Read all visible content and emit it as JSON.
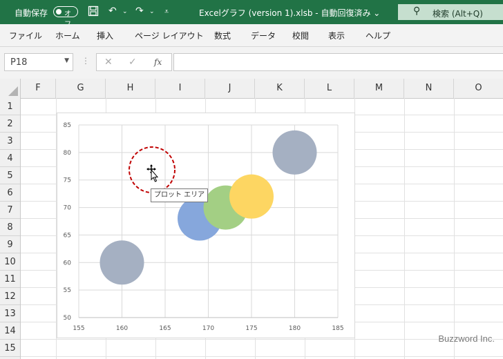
{
  "titlebar": {
    "autosave_label": "自動保存",
    "autosave_state": "オフ",
    "doc_title": "Excelグラフ (version 1).xlsb  -  自動回復済み ⌄",
    "search_label": "検索 (Alt+Q)",
    "icons": [
      "save-icon",
      "undo-icon",
      "redo-icon",
      "customize-qat-icon",
      "search-icon"
    ]
  },
  "ribbon": {
    "tabs": [
      "ファイル",
      "ホーム",
      "挿入",
      "ページ レイアウト",
      "数式",
      "データ",
      "校閲",
      "表示",
      "ヘルプ"
    ]
  },
  "formula_bar": {
    "name_box": "P18",
    "formula": ""
  },
  "columns": [
    "F",
    "G",
    "H",
    "I",
    "J",
    "K",
    "L",
    "M",
    "N",
    "O"
  ],
  "rows": [
    "1",
    "2",
    "3",
    "4",
    "5",
    "6",
    "7",
    "8",
    "9",
    "10",
    "11",
    "12",
    "13",
    "14",
    "15"
  ],
  "chart_data": {
    "type": "scatter",
    "xlim": [
      155,
      185
    ],
    "ylim": [
      50,
      85
    ],
    "x_ticks": [
      "155",
      "160",
      "165",
      "170",
      "175",
      "180",
      "185"
    ],
    "y_ticks": [
      "50",
      "55",
      "60",
      "65",
      "70",
      "75",
      "80",
      "85"
    ],
    "grid": true,
    "points": [
      {
        "x": 160,
        "y": 60,
        "color": "#a5b0c2"
      },
      {
        "x": 169,
        "y": 68,
        "color": "#86a7dc"
      },
      {
        "x": 172,
        "y": 70,
        "color": "#a3cf84"
      },
      {
        "x": 175,
        "y": 72,
        "color": "#fdd662"
      },
      {
        "x": 180,
        "y": 80,
        "color": "#a5b0c2"
      }
    ]
  },
  "tooltip": "プロット エリア",
  "watermark": "Buzzword Inc."
}
